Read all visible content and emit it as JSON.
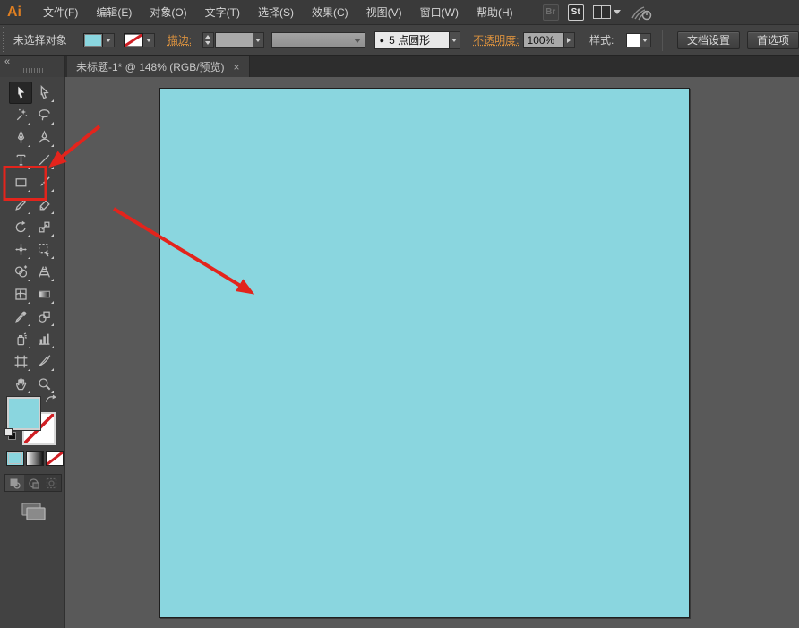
{
  "menubar": {
    "logo": "Ai",
    "items": [
      "文件(F)",
      "编辑(E)",
      "对象(O)",
      "文字(T)",
      "选择(S)",
      "效果(C)",
      "视图(V)",
      "窗口(W)",
      "帮助(H)"
    ],
    "bridge_icon_label": "Br",
    "stock_icon_label": "St"
  },
  "control_bar": {
    "selection_status": "未选择对象",
    "stroke_label": "描边:",
    "brush_bullet": "●",
    "brush_preset": "5 点圆形",
    "opacity_label": "不透明度:",
    "opacity_value": "100%",
    "style_label": "样式:",
    "document_setup_button": "文档设置",
    "preferences_button": "首选项"
  },
  "document_tab": {
    "title": "未标题-1* @ 148% (RGB/预览)",
    "close_glyph": "×"
  },
  "tool_panel": {
    "collapse_glyph": "«",
    "tools": [
      "selection",
      "direct-selection",
      "magic-wand",
      "lasso",
      "pen",
      "curvature",
      "type",
      "line-segment",
      "rectangle",
      "paintbrush",
      "pencil",
      "eraser",
      "rotate",
      "scale",
      "width",
      "free-transform",
      "shape-builder",
      "perspective-grid",
      "mesh",
      "gradient",
      "eyedropper",
      "blend",
      "symbol-sprayer",
      "column-graph",
      "artboard",
      "slice",
      "hand",
      "zoom"
    ],
    "selected_tool": "selection",
    "highlighted_tool": "rectangle"
  },
  "canvas": {
    "zoom_percent": "148%",
    "color_mode": "RGB"
  },
  "colors": {
    "artwork_fill": "#8ad6df",
    "annotation_red": "#e3241c",
    "link_orange": "#d9913f",
    "none_slash_red": "#cf1f24"
  }
}
